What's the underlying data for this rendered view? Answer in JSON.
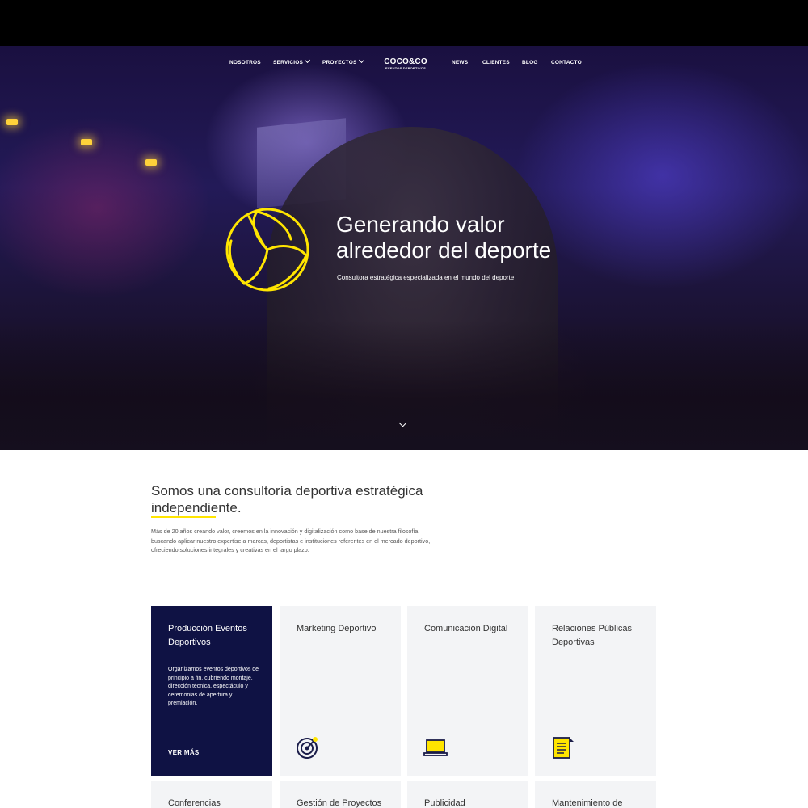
{
  "nav": {
    "left": [
      "NOSOTROS",
      "SERVICIOS",
      "PROYECTOS"
    ],
    "right": [
      "NEWS",
      "CLIENTES",
      "BLOG",
      "CONTACTO"
    ]
  },
  "logo": {
    "main": "COCO&CO",
    "sub": "EVENTOS DEPORTIVOS"
  },
  "hero": {
    "title_line1": "Generando valor",
    "title_line2": "alrededor del deporte",
    "subtitle": "Consultora estratégica especializada en el mundo del deporte"
  },
  "intro": {
    "title": "Somos una consultoría deportiva estratégica independiente.",
    "text": "Más de 20 años creando valor, creemos en la innovación y digitalización como base de nuestra filosofía, buscando aplicar nuestro expertise a marcas, deportistas e instituciones referentes en el mercado deportivo, ofreciendo soluciones integrales y creativas en el largo plazo."
  },
  "cards": [
    {
      "title": "Producción Eventos Deportivos",
      "desc": "Organizamos eventos deportivos de principio a fin, cubriendo montaje, dirección técnica, espectáculo y ceremonias de apertura y premiación.",
      "more": "VER MÁS"
    },
    {
      "title": "Marketing Deportivo",
      "icon": "target-icon"
    },
    {
      "title": "Comunicación Digital",
      "icon": "laptop-icon"
    },
    {
      "title": "Relaciones Públicas Deportivas",
      "icon": "document-icon"
    },
    {
      "title": "Conferencias"
    },
    {
      "title": "Gestión de Proyectos"
    },
    {
      "title": "Publicidad"
    },
    {
      "title": "Mantenimiento de"
    }
  ],
  "colors": {
    "accent": "#ffe500",
    "dark": "#0f1244",
    "card_bg": "#f3f4f6"
  }
}
